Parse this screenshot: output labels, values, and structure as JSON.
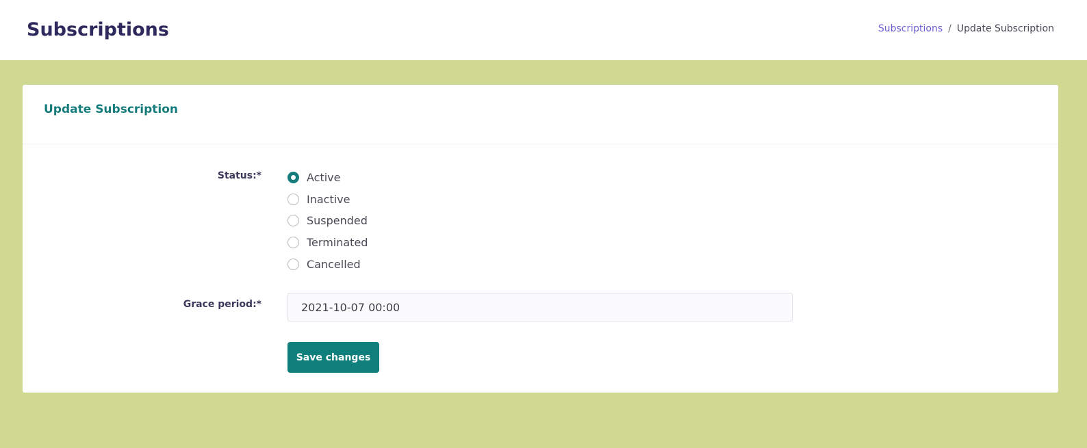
{
  "header": {
    "title": "Subscriptions",
    "breadcrumb": {
      "link_label": "Subscriptions",
      "separator": "/",
      "current": "Update Subscription"
    }
  },
  "card": {
    "title": "Update Subscription",
    "status": {
      "label": "Status:*",
      "options": [
        {
          "label": "Active",
          "checked": true
        },
        {
          "label": "Inactive",
          "checked": false
        },
        {
          "label": "Suspended",
          "checked": false
        },
        {
          "label": "Terminated",
          "checked": false
        },
        {
          "label": "Cancelled",
          "checked": false
        }
      ]
    },
    "grace_period": {
      "label": "Grace period:*",
      "value": "2021-10-07 00:00"
    },
    "save_label": "Save changes"
  },
  "colors": {
    "background": "#cfd992",
    "accent": "#167b7b",
    "button": "#0e7f7b",
    "link": "#6a5fd3",
    "title": "#2e2a5e"
  }
}
